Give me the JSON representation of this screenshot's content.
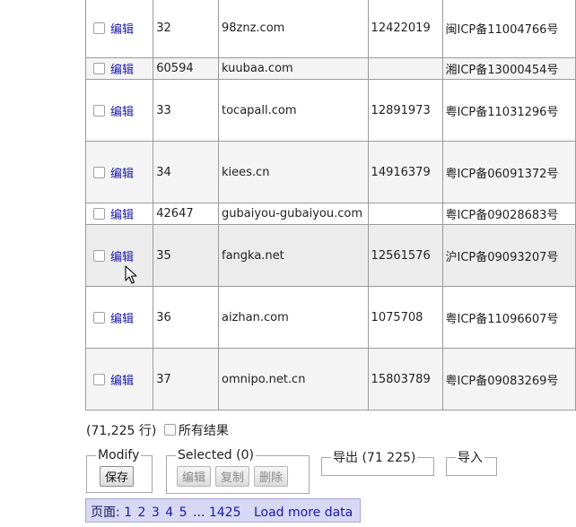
{
  "table": {
    "edit_label": "编辑",
    "rows": [
      {
        "id": "32",
        "domain": "98znz.com",
        "number": "12422019",
        "icp": "闽ICP备11004766号"
      },
      {
        "id": "60594",
        "domain": "kuubaa.com",
        "number": "",
        "icp": "湘ICP备13000454号"
      },
      {
        "id": "33",
        "domain": "tocapall.com",
        "number": "12891973",
        "icp": "粤ICP备11031296号"
      },
      {
        "id": "34",
        "domain": "kiees.cn",
        "number": "14916379",
        "icp": "粤ICP备06091372号"
      },
      {
        "id": "42647",
        "domain": "gubaiyou-gubaiyou.com",
        "number": "",
        "icp": "粤ICP备09028683号"
      },
      {
        "id": "35",
        "domain": "fangka.net",
        "number": "12561576",
        "icp": "沪ICP备09093207号"
      },
      {
        "id": "36",
        "domain": "aizhan.com",
        "number": "1075708",
        "icp": "粤ICP备11096607号"
      },
      {
        "id": "37",
        "domain": "omnipo.net.cn",
        "number": "15803789",
        "icp": "粤ICP备09083269号"
      }
    ]
  },
  "summary": {
    "row_count": "(71,225 行)",
    "all_results_label": "所有结果"
  },
  "modify": {
    "legend": "Modify",
    "save_label": "保存"
  },
  "selected": {
    "legend": "Selected (0)",
    "edit_label": "编辑",
    "copy_label": "复制",
    "delete_label": "删除"
  },
  "export": {
    "legend": "导出 (71 225)"
  },
  "import": {
    "legend": "导入"
  },
  "pager": {
    "label": "页面:",
    "pages": [
      "1",
      "2",
      "3",
      "4",
      "5"
    ],
    "ellipsis": "...",
    "last_page": "1425",
    "load_more": "Load more data"
  }
}
